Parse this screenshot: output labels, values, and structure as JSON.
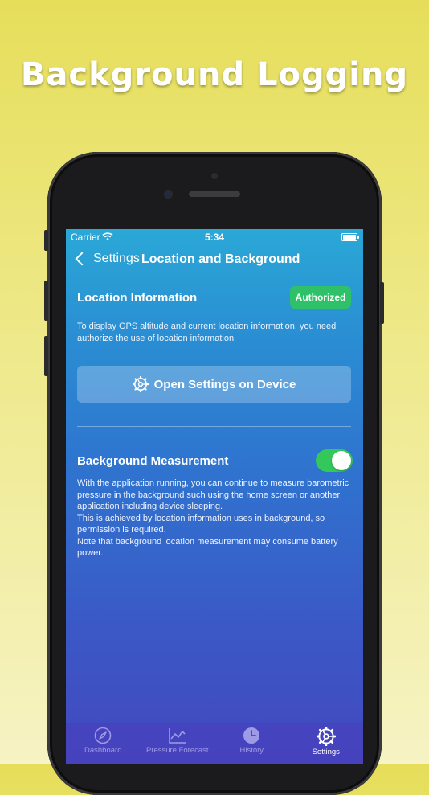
{
  "promo": {
    "title": "Background Logging"
  },
  "status_bar": {
    "carrier": "Carrier",
    "time": "5:34"
  },
  "nav": {
    "back_label": "Settings",
    "title": "Location and Background"
  },
  "location": {
    "heading": "Location Information",
    "badge": "Authorized",
    "description": "To display GPS altitude and current location information, you need authorize the use of location information.",
    "button_label": "Open Settings on Device"
  },
  "background": {
    "heading": "Background Measurement",
    "toggle_on": true,
    "description": "With the application running, you can continue to measure barometric pressure in the background such using the home screen or another application including device sleeping.\nThis is achieved by location information uses in background, so permission is required.\nNote that background location measurement may consume battery power."
  },
  "tabs": [
    {
      "label": "Dashboard",
      "icon": "compass-icon",
      "active": false
    },
    {
      "label": "Pressure Forecast",
      "icon": "chart-icon",
      "active": false
    },
    {
      "label": "History",
      "icon": "clock-icon",
      "active": false
    },
    {
      "label": "Settings",
      "icon": "gear-icon",
      "active": true
    }
  ],
  "colors": {
    "authorized_badge": "#2fc06a",
    "toggle_on": "#34c759",
    "tab_active": "#ffffff",
    "tab_inactive": "#9e9be6"
  }
}
